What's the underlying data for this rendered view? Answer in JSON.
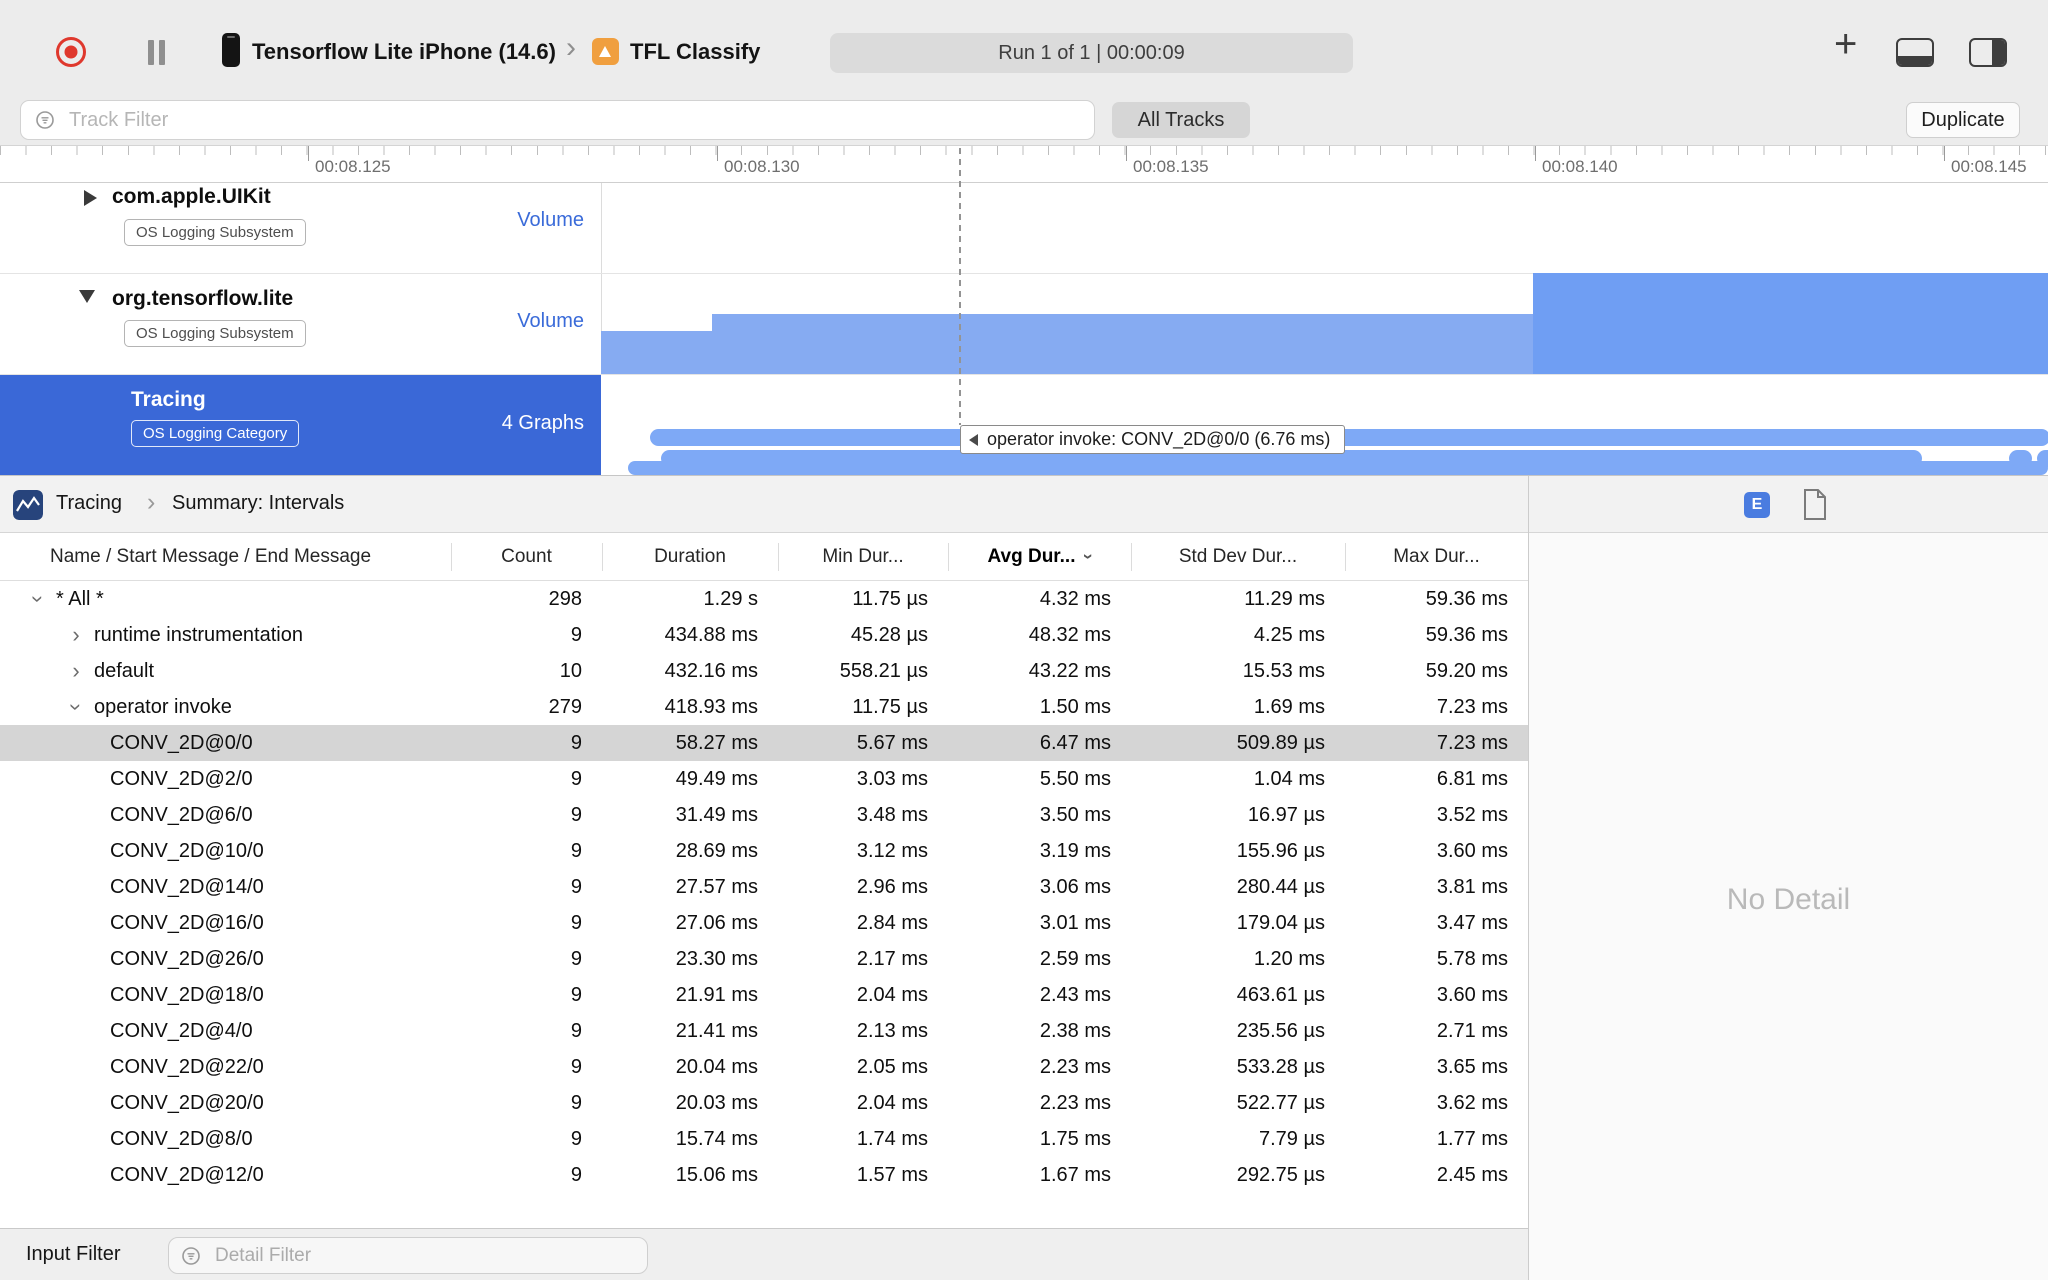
{
  "toolbar": {
    "device_name": "Tensorflow Lite iPhone (14.6)",
    "device_chevron": "›",
    "app_name": "TFL Classify",
    "run_status": "Run 1 of 1  |  00:00:09",
    "plus": "+"
  },
  "filter_bar": {
    "track_filter_placeholder": "Track Filter",
    "all_tracks": "All Tracks",
    "duplicate": "Duplicate"
  },
  "ruler": {
    "labels": [
      "00:08.125",
      "00:08.130",
      "00:08.135",
      "00:08.140",
      "00:08.145"
    ]
  },
  "tracks": [
    {
      "name": "com.apple.UIKit",
      "badge": "OS Logging Subsystem",
      "meta": "Volume"
    },
    {
      "name": "org.tensorflow.lite",
      "badge": "OS Logging Subsystem",
      "meta": "Volume"
    },
    {
      "name": "Tracing",
      "badge": "OS Logging Category",
      "meta": "4 Graphs"
    }
  ],
  "graph_tooltip": "operator invoke: CONV_2D@0/0 (6.76 ms)",
  "detail_pane": {
    "breadcrumb_root": "Tracing",
    "breadcrumb_sep": "›",
    "breadcrumb_view": "Summary: Intervals",
    "e_button": "E",
    "no_detail": "No Detail"
  },
  "table": {
    "columns": {
      "name": "Name / Start Message / End Message",
      "count": "Count",
      "duration": "Duration",
      "min": "Min Dur...",
      "avg": "Avg Dur...",
      "stddev": "Std Dev Dur...",
      "max": "Max Dur..."
    },
    "rows": [
      {
        "name": "* All *",
        "count": "298",
        "duration": "1.29 s",
        "min": "11.75 µs",
        "avg": "4.32 ms",
        "stddev": "11.29 ms",
        "max": "59.36 ms"
      },
      {
        "name": "runtime instrumentation",
        "count": "9",
        "duration": "434.88 ms",
        "min": "45.28 µs",
        "avg": "48.32 ms",
        "stddev": "4.25 ms",
        "max": "59.36 ms"
      },
      {
        "name": "default",
        "count": "10",
        "duration": "432.16 ms",
        "min": "558.21 µs",
        "avg": "43.22 ms",
        "stddev": "15.53 ms",
        "max": "59.20 ms"
      },
      {
        "name": "operator invoke",
        "count": "279",
        "duration": "418.93 ms",
        "min": "11.75 µs",
        "avg": "1.50 ms",
        "stddev": "1.69 ms",
        "max": "7.23 ms"
      },
      {
        "name": "CONV_2D@0/0",
        "count": "9",
        "duration": "58.27 ms",
        "min": "5.67 ms",
        "avg": "6.47 ms",
        "stddev": "509.89 µs",
        "max": "7.23 ms"
      },
      {
        "name": "CONV_2D@2/0",
        "count": "9",
        "duration": "49.49 ms",
        "min": "3.03 ms",
        "avg": "5.50 ms",
        "stddev": "1.04 ms",
        "max": "6.81 ms"
      },
      {
        "name": "CONV_2D@6/0",
        "count": "9",
        "duration": "31.49 ms",
        "min": "3.48 ms",
        "avg": "3.50 ms",
        "stddev": "16.97 µs",
        "max": "3.52 ms"
      },
      {
        "name": "CONV_2D@10/0",
        "count": "9",
        "duration": "28.69 ms",
        "min": "3.12 ms",
        "avg": "3.19 ms",
        "stddev": "155.96 µs",
        "max": "3.60 ms"
      },
      {
        "name": "CONV_2D@14/0",
        "count": "9",
        "duration": "27.57 ms",
        "min": "2.96 ms",
        "avg": "3.06 ms",
        "stddev": "280.44 µs",
        "max": "3.81 ms"
      },
      {
        "name": "CONV_2D@16/0",
        "count": "9",
        "duration": "27.06 ms",
        "min": "2.84 ms",
        "avg": "3.01 ms",
        "stddev": "179.04 µs",
        "max": "3.47 ms"
      },
      {
        "name": "CONV_2D@26/0",
        "count": "9",
        "duration": "23.30 ms",
        "min": "2.17 ms",
        "avg": "2.59 ms",
        "stddev": "1.20 ms",
        "max": "5.78 ms"
      },
      {
        "name": "CONV_2D@18/0",
        "count": "9",
        "duration": "21.91 ms",
        "min": "2.04 ms",
        "avg": "2.43 ms",
        "stddev": "463.61 µs",
        "max": "3.60 ms"
      },
      {
        "name": "CONV_2D@4/0",
        "count": "9",
        "duration": "21.41 ms",
        "min": "2.13 ms",
        "avg": "2.38 ms",
        "stddev": "235.56 µs",
        "max": "2.71 ms"
      },
      {
        "name": "CONV_2D@22/0",
        "count": "9",
        "duration": "20.04 ms",
        "min": "2.05 ms",
        "avg": "2.23 ms",
        "stddev": "533.28 µs",
        "max": "3.65 ms"
      },
      {
        "name": "CONV_2D@20/0",
        "count": "9",
        "duration": "20.03 ms",
        "min": "2.04 ms",
        "avg": "2.23 ms",
        "stddev": "522.77 µs",
        "max": "3.62 ms"
      },
      {
        "name": "CONV_2D@8/0",
        "count": "9",
        "duration": "15.74 ms",
        "min": "1.74 ms",
        "avg": "1.75 ms",
        "stddev": "7.79 µs",
        "max": "1.77 ms"
      },
      {
        "name": "CONV_2D@12/0",
        "count": "9",
        "duration": "15.06 ms",
        "min": "1.57 ms",
        "avg": "1.67 ms",
        "stddev": "292.75 µs",
        "max": "2.45 ms"
      }
    ]
  },
  "bottom_bar": {
    "input_filter": "Input Filter",
    "detail_filter_placeholder": "Detail Filter"
  },
  "colors": {
    "selection_blue": "#3a68d7",
    "graph_blue": "#7ea9f6",
    "graph_blue_dark": "#6f9ef3",
    "accent_blue": "#3a6bd9",
    "record_red": "#df382d"
  },
  "icons": {
    "record": "red-circle",
    "pause": "double-bars",
    "device": "iphone",
    "app": "orange-arrow-square",
    "add": "plus",
    "bottom_pane_toggle": "window-bottom-strip",
    "right_pane_toggle": "window-right-strip",
    "filter": "circle-with-lines",
    "instrument": "waveform-square",
    "document": "page-outline"
  }
}
